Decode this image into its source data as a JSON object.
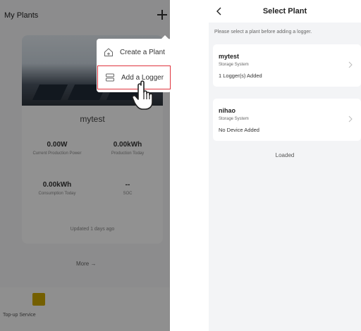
{
  "left": {
    "header": {
      "title": "My Plants",
      "add_icon": "plus-icon"
    },
    "plant_card": {
      "name": "mytest",
      "metrics": [
        {
          "value": "0.00W",
          "label": "Current Production Power"
        },
        {
          "value": "0.00kWh",
          "label": "Production Today"
        },
        {
          "value": "0.00kWh",
          "label": "Consumption Today"
        },
        {
          "value": "--",
          "label": "SOC"
        }
      ],
      "updated": "Updated 1 days ago"
    },
    "more_link": "More →",
    "topup": {
      "label": "Top-up Service"
    },
    "popup": {
      "items": [
        {
          "label": "Create a Plant",
          "icon": "house-plus-icon"
        },
        {
          "label": "Add a Logger",
          "icon": "logger-icon",
          "highlighted": true
        }
      ]
    },
    "cursor_icon": "pointing-hand-icon"
  },
  "right": {
    "header": {
      "title": "Select Plant",
      "back_icon": "chevron-left-icon"
    },
    "hint": "Please select a plant before adding a logger.",
    "plants": [
      {
        "name": "mytest",
        "type": "Storage System",
        "status": "1 Logger(s) Added"
      },
      {
        "name": "nihao",
        "type": "Storage System",
        "status": "No Device Added"
      }
    ],
    "footer": "Loaded"
  },
  "colors": {
    "highlight_border": "#e0343e",
    "overlay": "rgba(0,0,0,0.42)",
    "topup_icon": "#c9a400"
  }
}
